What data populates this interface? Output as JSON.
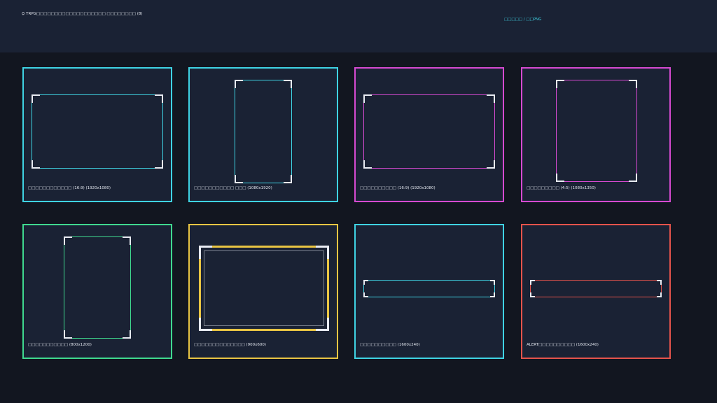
{
  "header": {
    "title": "⛭ TRPG□□□□□□□□□□□□□□□□□□□ □□□□□□□□ (8)",
    "link": "□□□□□ / □□PNG"
  },
  "colors": {
    "cyan": "#3fd3e3",
    "magenta": "#d64ad1",
    "green": "#3fd98f",
    "yellow": "#e9c543",
    "red": "#e5534b",
    "corner": "#e8ebf2"
  },
  "cards": [
    {
      "label": "□□□□□□□□□□□□ (16:9) (1920x1080)"
    },
    {
      "label": "□□□□□□□□□□□ □□□ (1080x1920)"
    },
    {
      "label": "□□□□□□□□□□ (16:9) (1920x1080)"
    },
    {
      "label": "□□□□□□□□□ (4:5) (1080x1350)"
    },
    {
      "label": "□□□□□□□□□□□ (800x1200)"
    },
    {
      "label": "□□□□□□□□□□□□□□ (900x600)"
    },
    {
      "label": "□□□□□□□□□□ (1600x240)"
    },
    {
      "label": "ALERT□□□□□□□□□□ (1600x240)"
    }
  ]
}
